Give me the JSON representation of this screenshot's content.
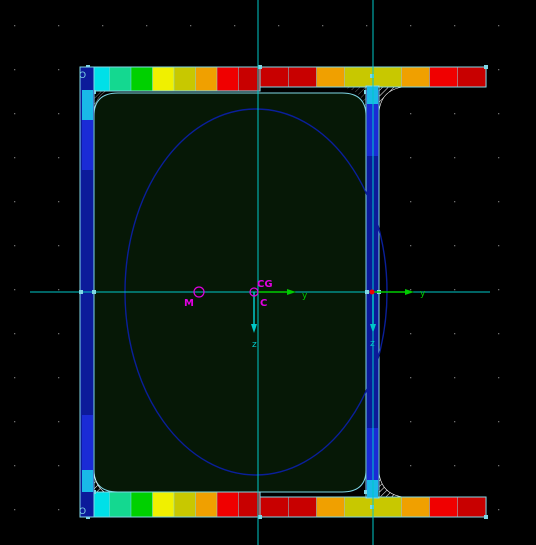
{
  "labels": {
    "cg": "CG",
    "shear_center": "C",
    "m_point": "M",
    "axis_y_main": "y",
    "axis_z_main": "z",
    "axis_y_local": "y",
    "axis_z_local": "z",
    "top_left_node": "O",
    "bottom_left_node": "O"
  },
  "colors": {
    "background": "#000000",
    "section_fill": "#061806",
    "outline": "#7fd7e6",
    "axis_cyan": "#00c8c8",
    "axis_green": "#00cc00",
    "ellipse": "#0a1f9a",
    "label_magenta": "#e000e0",
    "grid_dot": "#6e6e6e",
    "web_blue": "#1a2bd6",
    "web_blue_dark": "#0c1a9a",
    "web_cyan": "#19b9e8"
  },
  "stress_colors": {
    "top_left": [
      "#00e0e8",
      "#14d890",
      "#00d000",
      "#f0f000",
      "#c8c800",
      "#f0a000",
      "#f00000",
      "#c80000"
    ],
    "top_right": [
      "#c80000",
      "#c80000",
      "#f0a000",
      "#c8c800",
      "#c8c800",
      "#f0a000",
      "#f00000",
      "#c80000"
    ],
    "bottom_left": [
      "#00e0e8",
      "#14d890",
      "#00d000",
      "#f0f000",
      "#c8c800",
      "#f0a000",
      "#f00000",
      "#c80000"
    ],
    "bottom_right": [
      "#c80000",
      "#c80000",
      "#f0a000",
      "#c8c800",
      "#c8c800",
      "#f0a000",
      "#f00000",
      "#c80000"
    ]
  }
}
